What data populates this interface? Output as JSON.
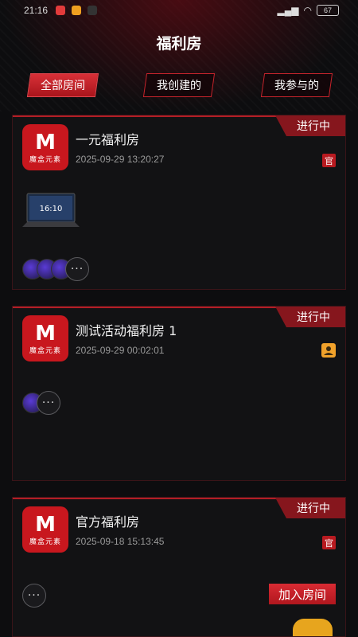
{
  "status_bar": {
    "time": "21:16",
    "battery": "67"
  },
  "page": {
    "title": "福利房"
  },
  "tabs": [
    {
      "label": "全部房间",
      "active": true
    },
    {
      "label": "我创建的",
      "active": false
    },
    {
      "label": "我参与的",
      "active": false
    }
  ],
  "rooms": [
    {
      "name": "一元福利房",
      "date": "2025-09-29 13:20:27",
      "status": "进行中",
      "tag": "官",
      "prize": "laptop",
      "laptop_time": "16:10",
      "participants_more": "···"
    },
    {
      "name": "测试活动福利房 1",
      "date": "2025-09-29 00:02:01",
      "status": "进行中",
      "tag_icon": "user-icon",
      "participants_more": "···"
    },
    {
      "name": "官方福利房",
      "date": "2025-09-18 15:13:45",
      "status": "进行中",
      "tag": "官",
      "participants_more": "···",
      "join_label": "加入房间"
    }
  ],
  "logo": {
    "mark": "M",
    "text": "魔盒元素"
  },
  "colors": {
    "accent": "#c8171e",
    "background": "#0d0d0f",
    "card": "#121214"
  }
}
